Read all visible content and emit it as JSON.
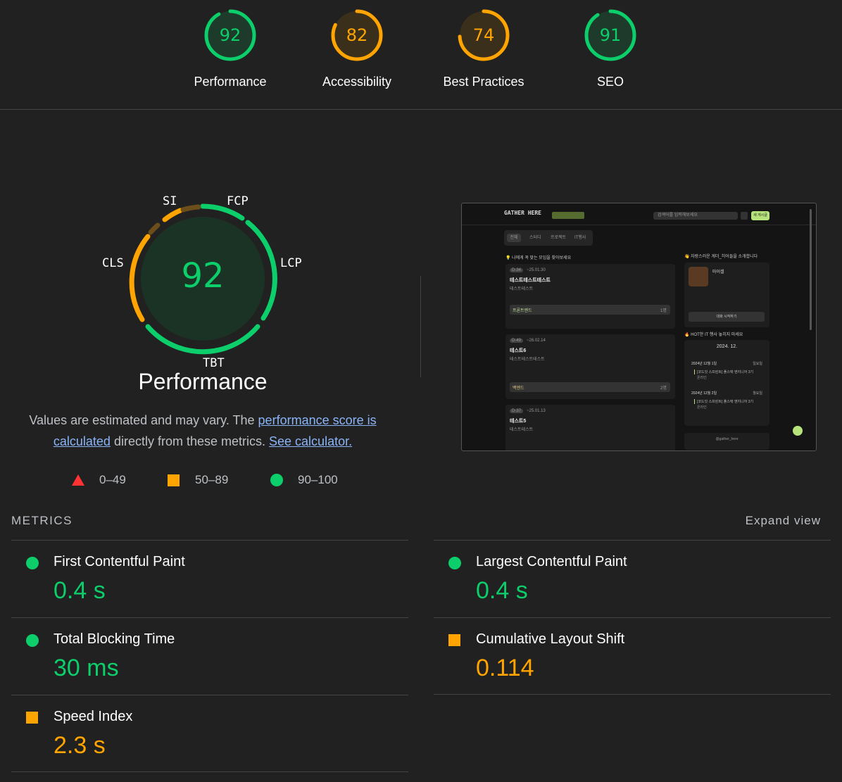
{
  "summary": [
    {
      "label": "Performance",
      "score": "92",
      "color": "#0cce6b",
      "fraction": 0.92
    },
    {
      "label": "Accessibility",
      "score": "82",
      "color": "#ffa400",
      "fraction": 0.82
    },
    {
      "label": "Best Practices",
      "score": "74",
      "color": "#ffa400",
      "fraction": 0.74
    },
    {
      "label": "SEO",
      "score": "91",
      "color": "#0cce6b",
      "fraction": 0.91
    }
  ],
  "gauge": {
    "score": "92",
    "title": "Performance",
    "labels": {
      "si": "SI",
      "fcp": "FCP",
      "lcp": "LCP",
      "tbt": "TBT",
      "cls": "CLS"
    }
  },
  "description": {
    "part1": "Values are estimated and may vary. The ",
    "link1": "performance score is calculated",
    "part2": " directly from these metrics. ",
    "link2": "See calculator."
  },
  "legend": {
    "fail": "0–49",
    "average": "50–89",
    "pass": "90–100"
  },
  "metrics_heading": "METRICS",
  "expand_label": "Expand view",
  "metrics": [
    {
      "name": "First Contentful Paint",
      "value": "0.4 s",
      "rating": "pass"
    },
    {
      "name": "Largest Contentful Paint",
      "value": "0.4 s",
      "rating": "pass"
    },
    {
      "name": "Total Blocking Time",
      "value": "30 ms",
      "rating": "pass"
    },
    {
      "name": "Cumulative Layout Shift",
      "value": "0.114",
      "rating": "average"
    },
    {
      "name": "Speed Index",
      "value": "2.3 s",
      "rating": "average"
    }
  ],
  "colors": {
    "pass": "#0cce6b",
    "average": "#ffa400",
    "fail": "#ff3333",
    "bg": "#212121"
  },
  "screenshot": {
    "logo": "GATHER HERE",
    "search_placeholder": "검색어를 입력해보세요",
    "new_post": "새 게시글",
    "tabs": [
      "전체",
      "스터디",
      "프로젝트",
      "IT행사"
    ],
    "section_left": "💡 나에게 꼭 맞는 모임을 찾아보세요",
    "section_right": "👋 자랑스러운 게더_히어들을 소개합니다",
    "cards": [
      {
        "badge": "D-34",
        "date": "~25.01.30",
        "title": "테스트테스트테스트",
        "sub": "테스트테스트",
        "tag": "프론트엔드",
        "count": "1명"
      },
      {
        "badge": "D-49",
        "date": "~26.02.14",
        "title": "테스트6",
        "sub": "테스트테스트테스트",
        "tag": "백엔드",
        "count": "2명"
      },
      {
        "badge": "D-37",
        "date": "~25.01.13",
        "title": "테스트5",
        "sub": "테스트테스트",
        "tag": "",
        "count": ""
      }
    ],
    "profile_name": "마이셀",
    "chat_button": "대화 시작하기",
    "hot_section": "🔥 HOT한 IT 행사 놓치지 마세요",
    "calendar_month": "2024. 12.",
    "events": [
      {
        "date": "2024년 12월 1일",
        "day": "일요일",
        "title": "[코드잇 스프린트] 풀스택 엔지니어 3기",
        "mode": "온라인"
      },
      {
        "date": "2024년 12월 2일",
        "day": "월요일",
        "title": "[코드잇 스프린트] 풀스택 엔지니어 3기",
        "mode": "온라인"
      }
    ],
    "footer": "@gather_here"
  }
}
